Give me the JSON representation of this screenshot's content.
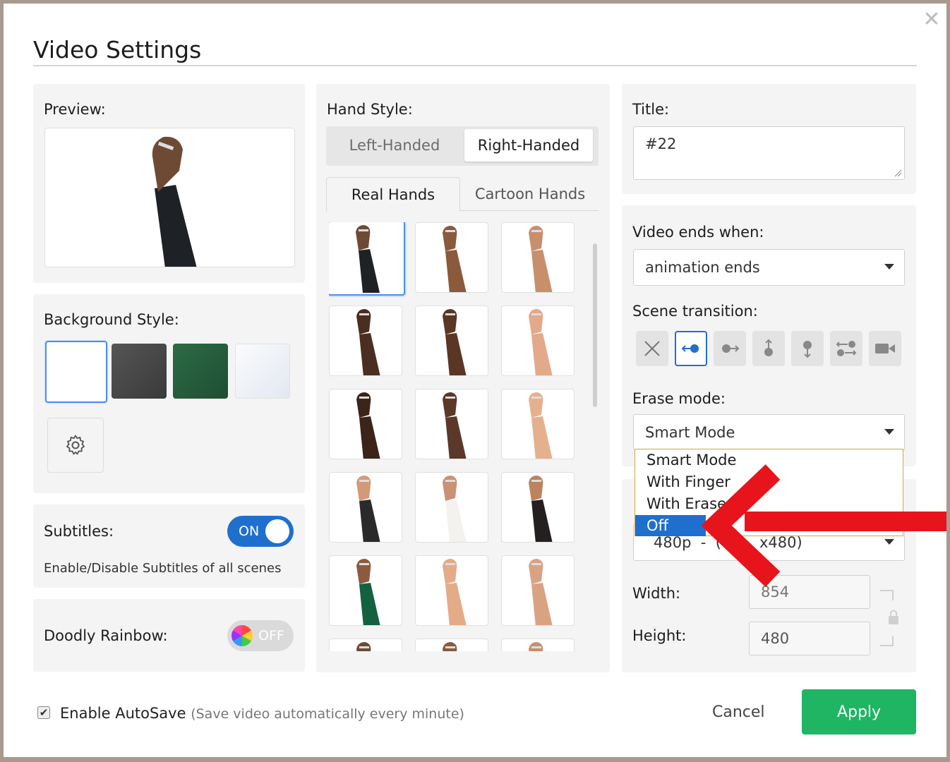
{
  "dialog": {
    "title": "Video Settings",
    "close_icon": "close-icon"
  },
  "preview": {
    "label": "Preview:"
  },
  "background": {
    "label": "Background Style:",
    "swatches": [
      {
        "name": "white",
        "color": "#ffffff"
      },
      {
        "name": "dark-chalkboard",
        "color": "#4a4a4a"
      },
      {
        "name": "green-chalkboard",
        "color": "#245c3a"
      },
      {
        "name": "light-glass",
        "color": "#eef1f6"
      }
    ]
  },
  "subtitles": {
    "label": "Subtitles:",
    "toggle": "ON",
    "description": "Enable/Disable Subtitles of all scenes"
  },
  "rainbow": {
    "label": "Doodly Rainbow:",
    "toggle": "OFF"
  },
  "hand_style": {
    "label": "Hand Style:",
    "handedness": [
      "Left-Handed",
      "Right-Handed"
    ],
    "selected_handedness": "Right-Handed",
    "tabs": [
      "Real Hands",
      "Cartoon Hands"
    ],
    "active_tab": "Real Hands"
  },
  "title_field": {
    "label": "Title:",
    "value": "#22"
  },
  "video_ends": {
    "label": "Video ends when:",
    "value": "animation ends"
  },
  "scene_transition": {
    "label": "Scene transition:",
    "icons": [
      "none-icon",
      "slide-left-icon",
      "slide-right-icon",
      "slide-up-icon",
      "slide-down-icon",
      "swap-icon",
      "camera-icon"
    ],
    "selected": "slide-left-icon"
  },
  "erase_mode": {
    "label": "Erase mode:",
    "value": "Smart Mode",
    "options": [
      "Smart Mode",
      "With Finger",
      "With Eraser",
      "Off"
    ],
    "highlighted": "Off"
  },
  "resolution": {
    "value": "480p  -  (854x480)",
    "visible_text_left": "480p  -  (",
    "visible_text_right": "x480)"
  },
  "width": {
    "label": "Width:",
    "value": "854"
  },
  "height": {
    "label": "Height:",
    "value": "480"
  },
  "footer": {
    "autosave_label": "Enable AutoSave",
    "autosave_note": "(Save video automatically every minute)",
    "cancel": "Cancel",
    "apply": "Apply"
  },
  "colors": {
    "accent_blue": "#1f6fcf",
    "apply_green": "#1fb563",
    "arrow_red": "#e8141b"
  }
}
